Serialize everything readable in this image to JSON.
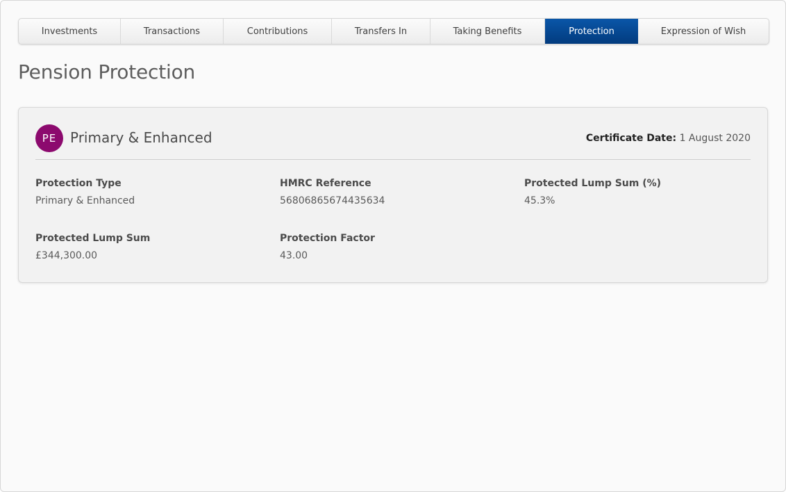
{
  "tabs": [
    {
      "label": "Investments"
    },
    {
      "label": "Transactions"
    },
    {
      "label": "Contributions"
    },
    {
      "label": "Transfers In"
    },
    {
      "label": "Taking Benefits"
    },
    {
      "label": "Protection"
    },
    {
      "label": "Expression of Wish"
    }
  ],
  "active_tab": "Protection",
  "page": {
    "title": "Pension Protection"
  },
  "card": {
    "avatar_initials": "PE",
    "avatar_color": "#8c0a6e",
    "title": "Primary & Enhanced",
    "certificate_date_label": "Certificate Date:",
    "certificate_date": "1 August 2020",
    "fields": [
      {
        "label": "Protection Type",
        "value": "Primary & Enhanced"
      },
      {
        "label": "HMRC Reference",
        "value": "56806865674435634"
      },
      {
        "label": "Protected Lump Sum (%)",
        "value": "45.3%"
      },
      {
        "label": "Protected Lump Sum",
        "value": "£344,300.00"
      },
      {
        "label": "Protection Factor",
        "value": "43.00"
      }
    ]
  },
  "colors": {
    "active_tab": "#023b7e",
    "avatar": "#8c0a6e"
  }
}
